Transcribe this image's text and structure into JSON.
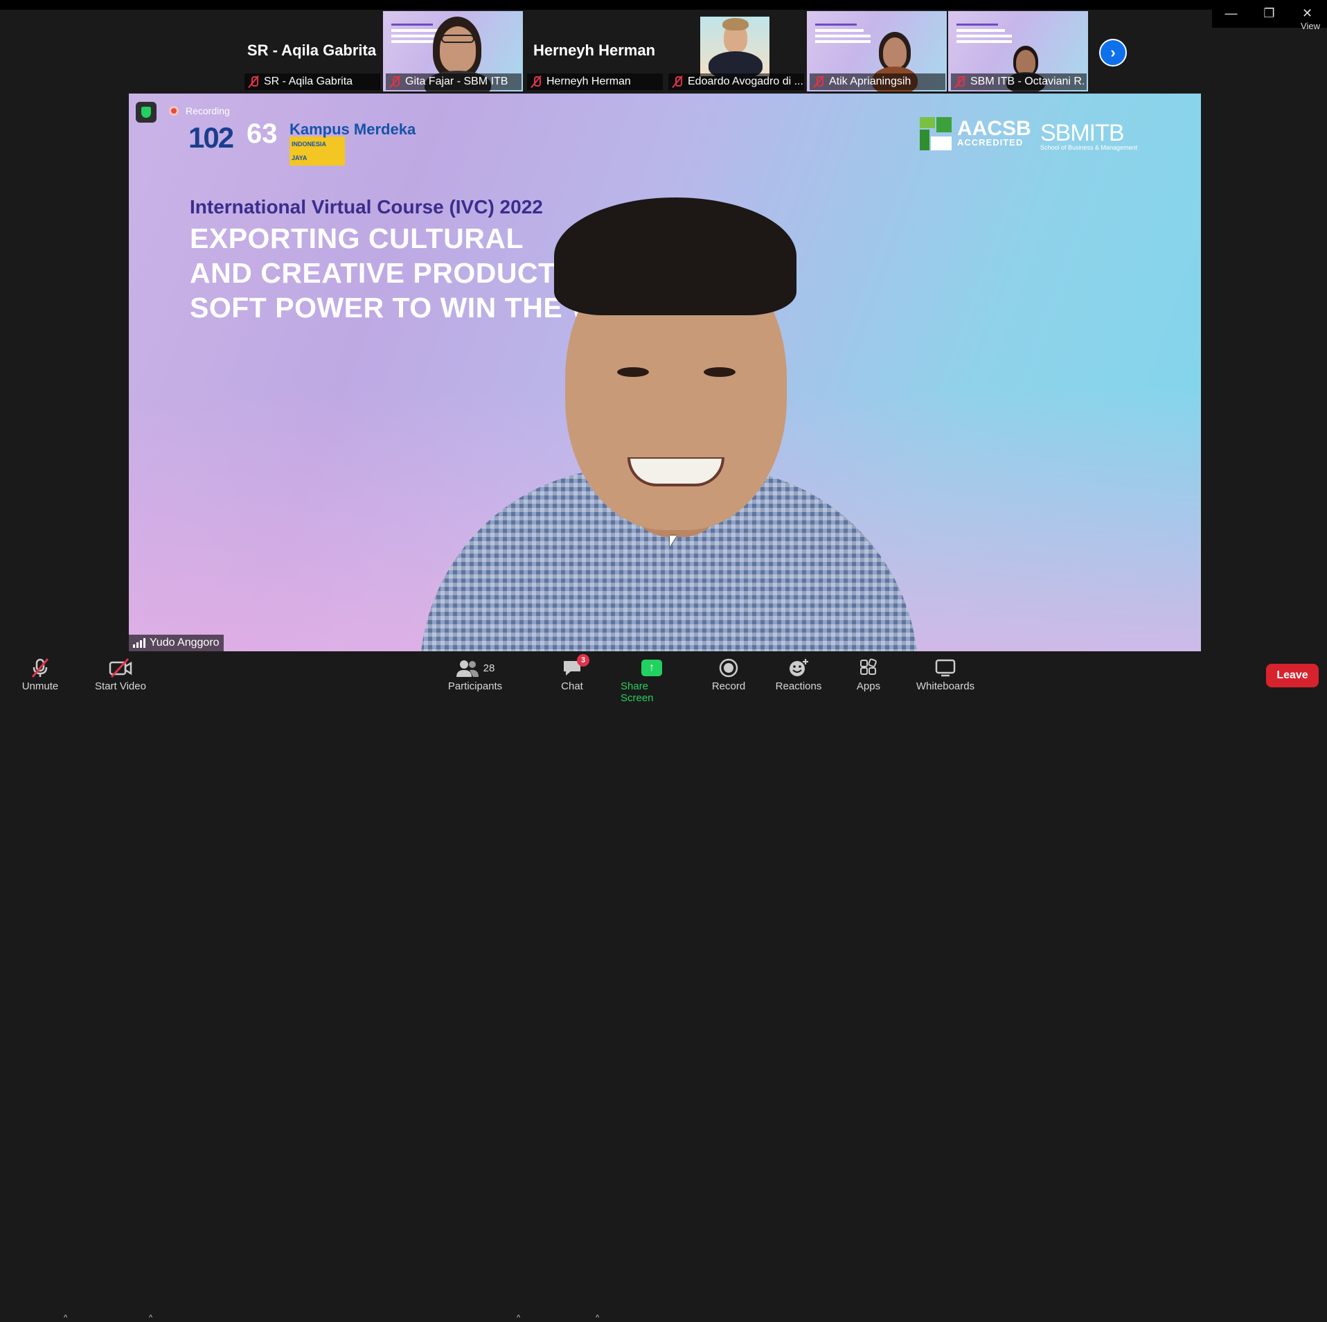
{
  "window": {
    "view_label": "View",
    "minimize_glyph": "—",
    "restore_glyph": "❐",
    "close_glyph": "✕"
  },
  "gallery": {
    "tiles": [
      {
        "name": "SR - Aqila Gabrita",
        "big_name": "SR - Aqila Gabrita",
        "video": false
      },
      {
        "name": "Gita Fajar - SBM ITB",
        "video": true
      },
      {
        "name": "Herneyh Herman",
        "big_name": "Herneyh Herman",
        "video": false
      },
      {
        "name": "Edoardo Avogadro di ...",
        "video": true
      },
      {
        "name": "Atik Aprianingsih",
        "video": true
      },
      {
        "name": "SBM ITB - Octaviani R. ...",
        "video": true
      }
    ],
    "next_glyph": "›"
  },
  "main": {
    "recording_label": "Recording",
    "speaker_name": "Yudo Anggoro",
    "slide": {
      "logo_102": "102",
      "logo_63": "63",
      "logo_km": "Kampus Merdeka",
      "logo_km_sub": "INDONESIA JAYA",
      "aacsb": "AACSB",
      "aacsb_sub": "ACCREDITED",
      "sbm": "SBMITB",
      "sbm_sub": "School of Business & Management",
      "title": "International Virtual Course (IVC) 2022",
      "line1": "EXPORTING CULTURAL",
      "line2": "AND CREATIVE PRODUCTS",
      "line3": "SOFT POWER TO WIN THE W"
    }
  },
  "toolbar": {
    "unmute": "Unmute",
    "start_video": "Start Video",
    "participants": "Participants",
    "participants_count": "28",
    "chat": "Chat",
    "chat_badge": "3",
    "share_screen": "Share Screen",
    "record": "Record",
    "reactions": "Reactions",
    "apps": "Apps",
    "whiteboards": "Whiteboards",
    "leave": "Leave",
    "caret": "^"
  },
  "colors": {
    "accent_blue": "#0e71eb",
    "share_green": "#23d160",
    "leave_red": "#d6232d",
    "muted_red": "#e0334b"
  }
}
